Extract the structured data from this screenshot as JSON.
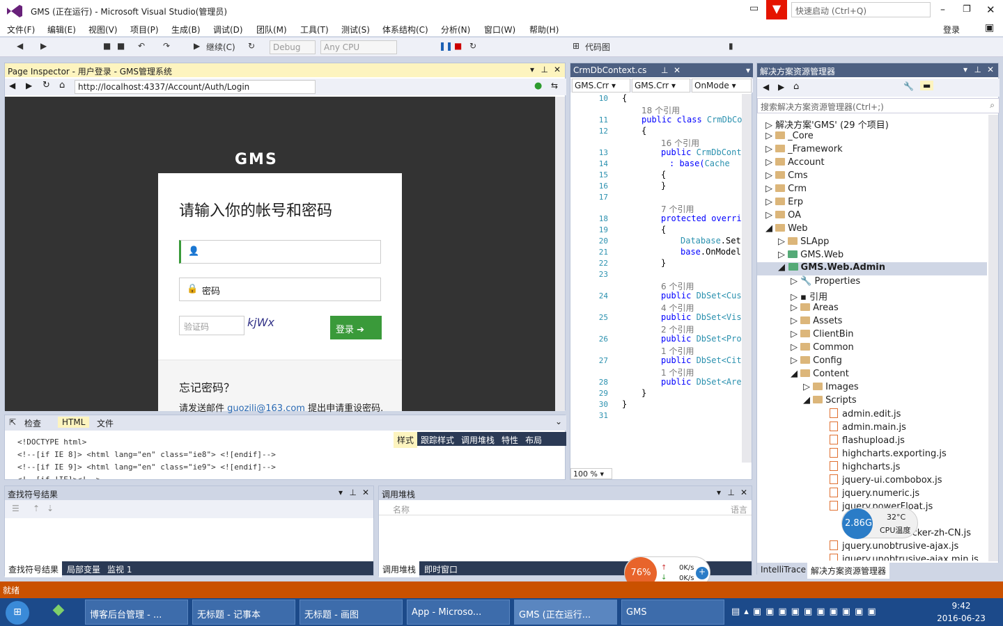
{
  "window": {
    "title": "GMS (正在运行) - Microsoft Visual Studio(管理员)",
    "quick_launch": "快速启动 (Ctrl+Q)",
    "login": "登录"
  },
  "menu": [
    "文件(F)",
    "编辑(E)",
    "视图(V)",
    "项目(P)",
    "生成(B)",
    "调试(D)",
    "团队(M)",
    "工具(T)",
    "测试(S)",
    "体系结构(C)",
    "分析(N)",
    "窗口(W)",
    "帮助(H)"
  ],
  "toolbar": {
    "continue": "继续(C)",
    "config": "Debug",
    "platform": "Any CPU",
    "codemap": "代码图"
  },
  "page_inspector": {
    "title": "Page Inspector - 用户登录 - GMS管理系统",
    "url": "http://localhost:4337/Account/Auth/Login",
    "logo": "GMS",
    "login_title": "请输入你的帐号和密码",
    "password_placeholder": "密码",
    "captcha_placeholder": "验证码",
    "captcha_text": "kjWx",
    "login_button": "登录",
    "forgot_title": "忘记密码？",
    "forgot_text": "请发送邮件",
    "forgot_email": "guozili@163.com",
    "forgot_text2": "提出申请重设密码.",
    "tab_inspect": "检查",
    "tab_html": "HTML",
    "tab_file": "文件",
    "html_lines": [
      "<!DOCTYPE html>",
      "<!--[if IE 8]> <html lang=\"en\" class=\"ie8\"> <![endif]-->",
      "<!--[if IE 9]> <html lang=\"en\" class=\"ie9\"> <![endif]-->",
      "<!--[if !IE]><!-->"
    ],
    "style_tabs": [
      "样式",
      "跟踪样式",
      "调用堆栈",
      "特性",
      "布局"
    ]
  },
  "editor": {
    "tab": "CrmDbContext.cs",
    "combo1": "GMS.Crr",
    "combo2": "GMS.Crr",
    "combo3": "OnMode",
    "zoom": "100 %",
    "lines": [
      "10",
      "11",
      "12",
      "13",
      "14",
      "15",
      "16",
      "17",
      "18",
      "19",
      "20",
      "21",
      "22",
      "23",
      "24",
      "25",
      "26",
      "27",
      "28",
      "29",
      "30",
      "31"
    ],
    "refs": {
      "r18": "18 个引用",
      "r16": "16 个引用",
      "r7": "7 个引用",
      "r6": "6 个引用",
      "r4": "4 个引用",
      "r2": "2 个引用",
      "r1a": "1 个引用",
      "r1b": "1 个引用"
    },
    "code": {
      "c10": "{",
      "c11a": "public class ",
      "c11b": "CrmDbCo",
      "c12": "{",
      "c13a": "public ",
      "c13b": "CrmDbCont",
      "c14a": ": base(",
      "c14b": "Cache",
      "c15": "{",
      "c16": "}",
      "c18": "protected overri",
      "c19": "{",
      "c20a": "Database",
      "c20b": ".Set",
      "c21a": "base",
      "c21b": ".OnModel",
      "c22": "}",
      "c24a": "public ",
      "c24b": "DbSet<Cus",
      "c25a": "public ",
      "c25b": "DbSet<Vis",
      "c26a": "public ",
      "c26b": "DbSet<Pro",
      "c27a": "public ",
      "c27b": "DbSet<Cit",
      "c28a": "public ",
      "c28b": "DbSet<Are",
      "c29": "}",
      "c30": "}"
    }
  },
  "solution": {
    "title": "解决方案资源管理器",
    "search": "搜索解决方案资源管理器(Ctrl+;)",
    "root": "解决方案'GMS' (29 个项目)",
    "items": [
      "_Core",
      "_Framework",
      "Account",
      "Cms",
      "Crm",
      "Erp",
      "OA",
      "Web",
      "SLApp",
      "GMS.Web",
      "GMS.Web.Admin",
      "Properties",
      "引用",
      "Areas",
      "Assets",
      "ClientBin",
      "Common",
      "Config",
      "Content",
      "Images",
      "Scripts",
      "admin.edit.js",
      "admin.main.js",
      "flashupload.js",
      "highcharts.exporting.js",
      "highcharts.js",
      "jquery-ui.combobox.js",
      "jquery.numeric.js",
      "jquery.powerFloat.js",
      "jquery.ui.datepicker-zh-CN.js",
      "jquery.unobtrusive-ajax.js",
      "jquery.unobtrusive-ajax.min.js"
    ],
    "tab_intellitrace": "IntelliTrace",
    "tab_solution": "解决方案资源管理器"
  },
  "find_results": {
    "title": "查找符号结果",
    "tabs": [
      "查找符号结果",
      "局部变量",
      "监视 1"
    ]
  },
  "call_stack": {
    "title": "调用堆栈",
    "col_name": "名称",
    "col_lang": "语言",
    "tabs": [
      "调用堆栈",
      "即时窗口"
    ]
  },
  "status": "就绪",
  "cpu": {
    "value": "2.86G",
    "temp": "32°C",
    "label": "CPU温度"
  },
  "net": {
    "percent": "76%",
    "up": "0K/s",
    "down": "0K/s"
  },
  "taskbar": {
    "items": [
      "博客后台管理 - ...",
      "无标题 - 记事本",
      "无标题 - 画图",
      "App - Microso...",
      "GMS (正在运行...",
      "GMS"
    ],
    "time": "9:42",
    "date": "2016-06-23"
  },
  "colors": {
    "accent": "#4d6082",
    "status": "#ca5100",
    "taskbar": "#1c4a8a",
    "login_green": "#3a9a3a"
  }
}
